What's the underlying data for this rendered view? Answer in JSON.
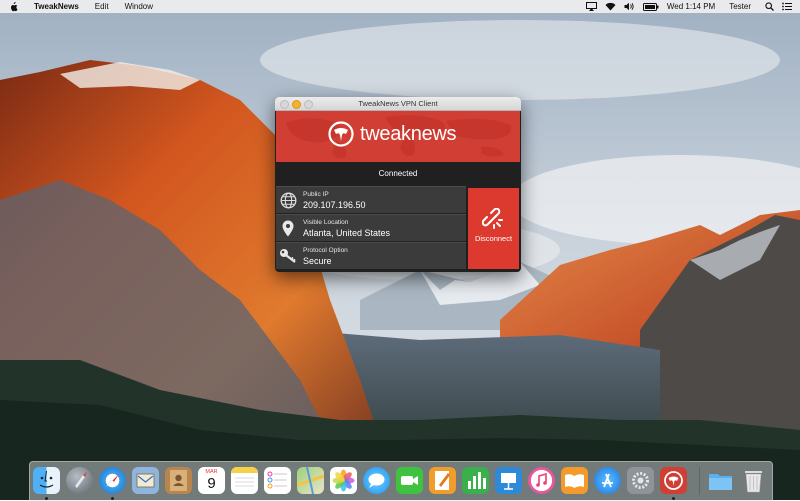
{
  "menubar": {
    "app_name": "TweakNews",
    "items": [
      "Edit",
      "Window"
    ],
    "clock": "Wed 1:14 PM",
    "user": "Tester"
  },
  "window": {
    "title": "TweakNews VPN Client",
    "brand": "tweaknews",
    "status": "Connected",
    "rows": [
      {
        "label": "Public IP",
        "value": "209.107.196.50",
        "icon": "globe-icon"
      },
      {
        "label": "Visible Location",
        "value": "Atlanta, United States",
        "icon": "location-pin-icon"
      },
      {
        "label": "Protocol Option",
        "value": "Secure",
        "icon": "key-icon"
      }
    ],
    "disconnect_label": "Disconnect",
    "accent": "#d13e33"
  },
  "dock": {
    "calendar_month": "MAR",
    "calendar_day": "9",
    "apps": [
      "finder",
      "launchpad",
      "safari",
      "mail",
      "contacts",
      "calendar",
      "notes",
      "reminders",
      "maps",
      "photos",
      "messages",
      "facetime",
      "pages",
      "numbers",
      "keynote",
      "itunes",
      "ibooks",
      "app-store",
      "system-preferences",
      "tweaknews",
      "downloads-folder",
      "trash"
    ]
  }
}
